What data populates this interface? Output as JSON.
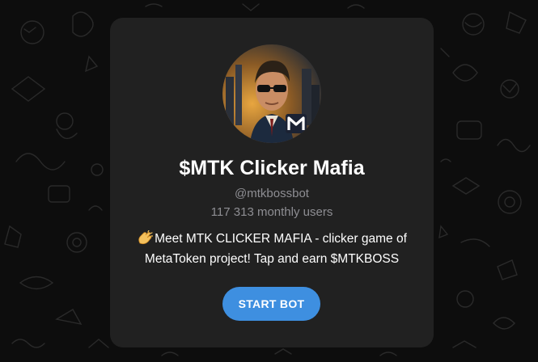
{
  "bot": {
    "name": "$MTK Clicker Mafia",
    "handle": "@mtkbossbot",
    "monthly_users": "117 313 monthly users",
    "description_line1": "Meet MTK CLICKER MAFIA - clicker game of",
    "description_line2": "MetaToken project! Tap and earn $MTKBOSS",
    "description_emoji_icon": "clapping-hands-icon",
    "avatar_icon": "mafia-boss-avatar"
  },
  "actions": {
    "start_label": "START BOT"
  },
  "colors": {
    "background": "#0d0d0d",
    "card": "#212121",
    "accent": "#3e8fe0",
    "secondary_text": "#8e8e93"
  }
}
